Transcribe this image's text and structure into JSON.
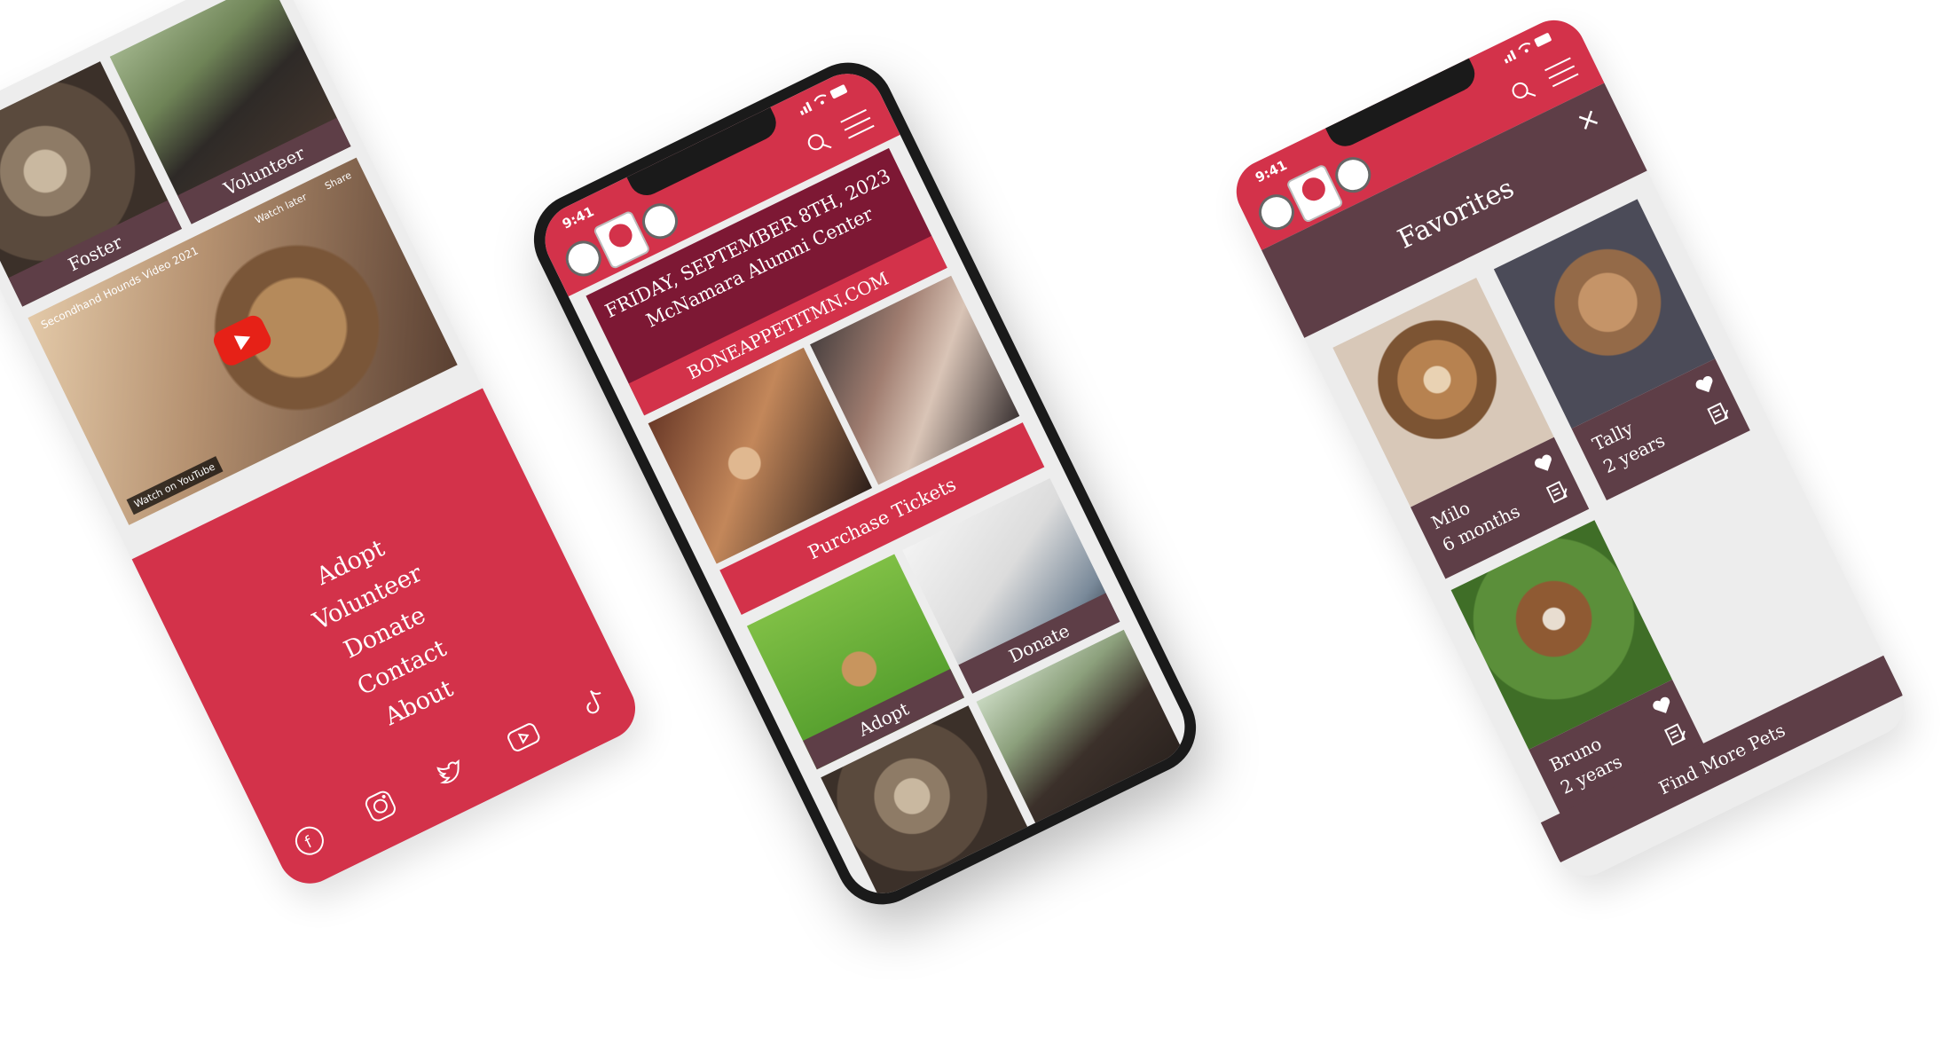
{
  "colors": {
    "primary_red": "#d3324a",
    "maroon": "#5e3e47",
    "dark_red": "#7d1834",
    "background": "#ededed"
  },
  "left_phone": {
    "tiles": [
      {
        "label": "Foster",
        "icon": "kitten-photo"
      },
      {
        "label": "Volunteer",
        "icon": "volunteer-photo"
      }
    ],
    "video": {
      "title": "Secondhand Hounds Video 2021",
      "watch_later": "Watch later",
      "share": "Share",
      "watch_on": "Watch on",
      "platform": "YouTube"
    },
    "nav": [
      "Adopt",
      "Volunteer",
      "Donate",
      "Contact",
      "About"
    ],
    "social": [
      "facebook-icon",
      "instagram-icon",
      "twitter-icon",
      "youtube-icon",
      "tiktok-icon"
    ]
  },
  "center_phone": {
    "status": {
      "time": "9:41"
    },
    "event": {
      "date": "FRIDAY, SEPTEMBER 8TH, 2023",
      "venue": "McNamara Alumni Center",
      "url": "BONEAPPETITMN.COM"
    },
    "tickets_button": "Purchase Tickets",
    "tiles": [
      {
        "label": "Adopt"
      },
      {
        "label": "Donate"
      }
    ]
  },
  "right_phone": {
    "status": {
      "time": "9:41"
    },
    "title": "Favorites",
    "close": "×",
    "pets": [
      {
        "name": "Milo",
        "age": "6 months"
      },
      {
        "name": "Tally",
        "age": "2 years"
      },
      {
        "name": "Bruno",
        "age": "2 years"
      }
    ],
    "find_more": "Find More Pets"
  }
}
